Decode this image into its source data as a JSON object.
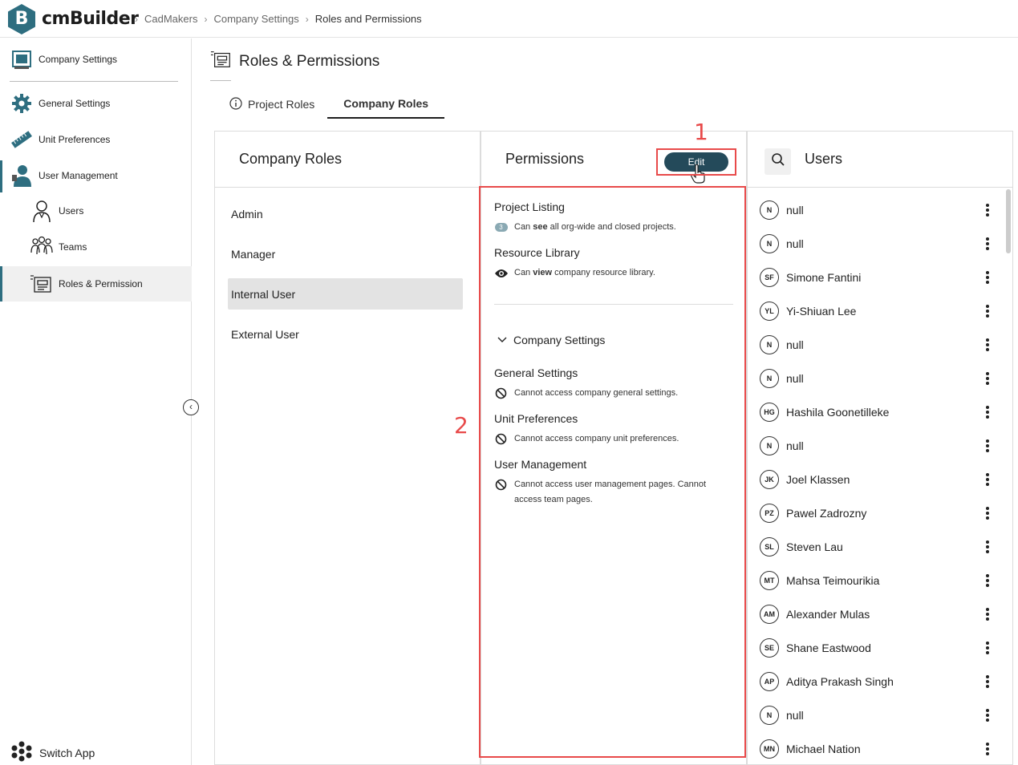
{
  "app": {
    "logo_letter": "B",
    "name": "cmBuilder"
  },
  "breadcrumb": [
    "CadMakers",
    "Company Settings",
    "Roles and Permissions"
  ],
  "sidebar": {
    "company_settings": "Company Settings",
    "general_settings": "General Settings",
    "unit_preferences": "Unit Preferences",
    "user_management": "User Management",
    "users": "Users",
    "teams": "Teams",
    "roles_permission": "Roles & Permission",
    "switch_app": "Switch App"
  },
  "page": {
    "title": "Roles & Permissions",
    "tabs": [
      {
        "label": "Project Roles",
        "active": false
      },
      {
        "label": "Company Roles",
        "active": true
      }
    ]
  },
  "roles_panel": {
    "title": "Company Roles",
    "roles": [
      "Admin",
      "Manager",
      "Internal User",
      "External User"
    ],
    "selected": "Internal User"
  },
  "permissions_panel": {
    "title": "Permissions",
    "edit_label": "Edit",
    "project_listing": {
      "title": "Project Listing",
      "badge": "3",
      "desc_pre": "Can ",
      "desc_bold": "see",
      "desc_post": " all org-wide and closed projects."
    },
    "resource_library": {
      "title": "Resource Library",
      "desc_pre": "Can ",
      "desc_bold": "view",
      "desc_post": " company resource library."
    },
    "company_settings_section": "Company Settings",
    "general_settings": {
      "title": "General Settings",
      "desc": "Cannot access company general settings."
    },
    "unit_preferences": {
      "title": "Unit Preferences",
      "desc": "Cannot access company unit preferences."
    },
    "user_management": {
      "title": "User Management",
      "desc": "Cannot access user management pages. Cannot access team pages."
    }
  },
  "annotations": {
    "one": "1",
    "two": "2",
    "color": "#e84a4a"
  },
  "users_panel": {
    "title": "Users",
    "users": [
      {
        "initials": "N",
        "name": "null"
      },
      {
        "initials": "N",
        "name": "null"
      },
      {
        "initials": "SF",
        "name": "Simone Fantini"
      },
      {
        "initials": "YL",
        "name": "Yi-Shiuan Lee"
      },
      {
        "initials": "N",
        "name": "null"
      },
      {
        "initials": "N",
        "name": "null"
      },
      {
        "initials": "HG",
        "name": "Hashila Goonetilleke"
      },
      {
        "initials": "N",
        "name": "null"
      },
      {
        "initials": "JK",
        "name": "Joel Klassen"
      },
      {
        "initials": "PZ",
        "name": "Pawel Zadrozny"
      },
      {
        "initials": "SL",
        "name": "Steven Lau"
      },
      {
        "initials": "MT",
        "name": "Mahsa Teimourikia"
      },
      {
        "initials": "AM",
        "name": "Alexander Mulas"
      },
      {
        "initials": "SE",
        "name": "Shane Eastwood"
      },
      {
        "initials": "AP",
        "name": "Aditya Prakash Singh"
      },
      {
        "initials": "N",
        "name": "null"
      },
      {
        "initials": "MN",
        "name": "Michael Nation"
      }
    ]
  },
  "colors": {
    "brand": "#2e6e80",
    "edit_button": "#244a5a"
  }
}
